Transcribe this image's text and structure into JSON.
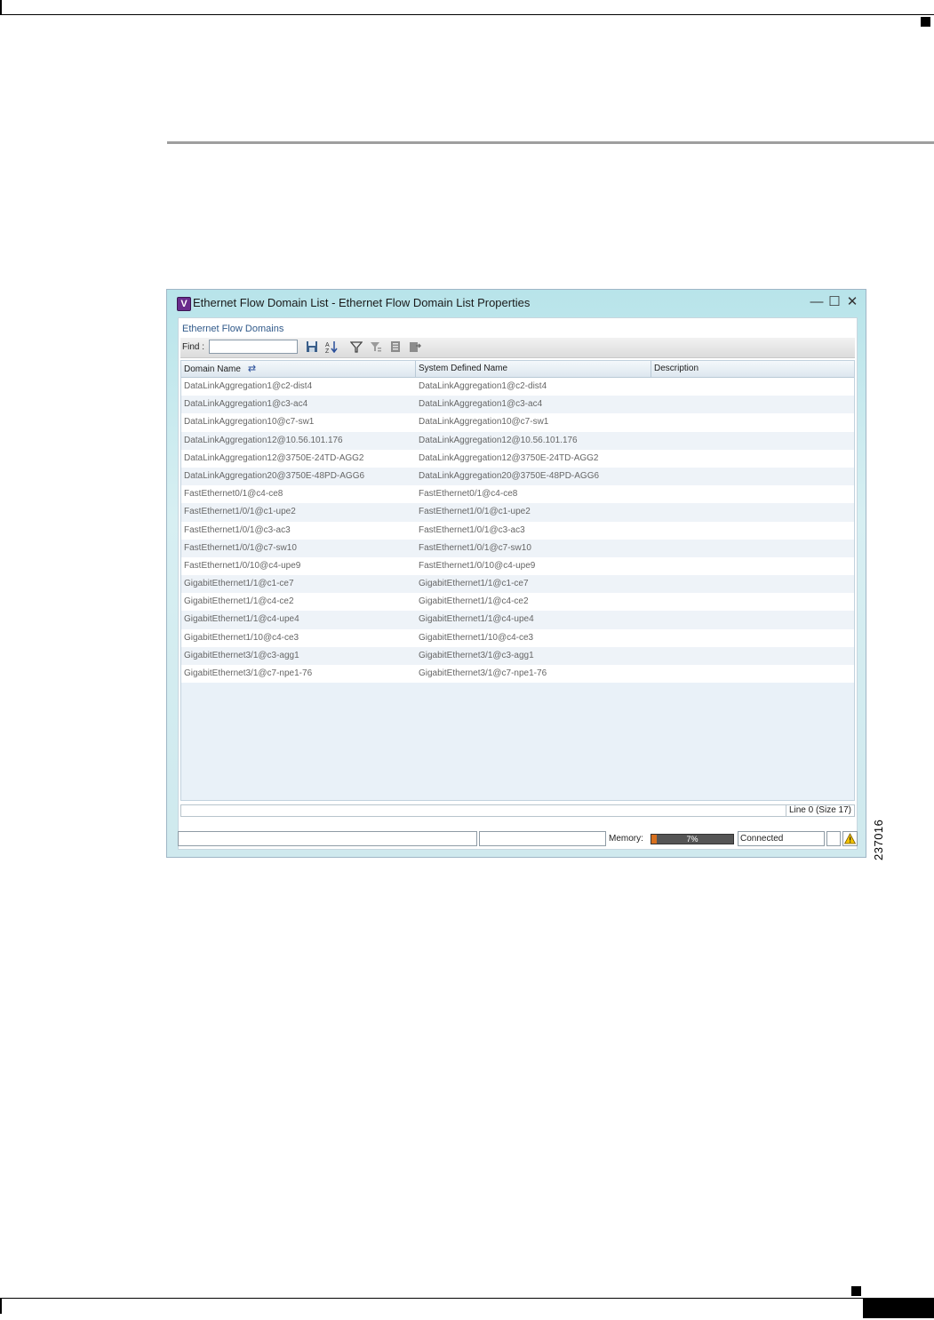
{
  "figure_id": "237016",
  "window": {
    "app_icon_letter": "V",
    "title": "Ethernet Flow Domain List - Ethernet Flow Domain List Properties",
    "minimize_glyph": "—",
    "maximize_glyph": "☐",
    "close_glyph": "✕"
  },
  "panel": {
    "title": "Ethernet Flow Domains",
    "find_label": "Find :",
    "find_value": ""
  },
  "toolbar": {
    "icons": [
      "save-icon",
      "sort-icon",
      "filter-icon",
      "advanced-filter-icon",
      "export-icon",
      "export-all-icon"
    ]
  },
  "table": {
    "columns": [
      "Domain Name",
      "System Defined Name",
      "Description"
    ],
    "rows": [
      [
        "DataLinkAggregation1@c2-dist4",
        "DataLinkAggregation1@c2-dist4",
        ""
      ],
      [
        "DataLinkAggregation1@c3-ac4",
        "DataLinkAggregation1@c3-ac4",
        ""
      ],
      [
        "DataLinkAggregation10@c7-sw1",
        "DataLinkAggregation10@c7-sw1",
        ""
      ],
      [
        "DataLinkAggregation12@10.56.101.176",
        "DataLinkAggregation12@10.56.101.176",
        ""
      ],
      [
        "DataLinkAggregation12@3750E-24TD-AGG2",
        "DataLinkAggregation12@3750E-24TD-AGG2",
        ""
      ],
      [
        "DataLinkAggregation20@3750E-48PD-AGG6",
        "DataLinkAggregation20@3750E-48PD-AGG6",
        ""
      ],
      [
        "FastEthernet0/1@c4-ce8",
        "FastEthernet0/1@c4-ce8",
        ""
      ],
      [
        "FastEthernet1/0/1@c1-upe2",
        "FastEthernet1/0/1@c1-upe2",
        ""
      ],
      [
        "FastEthernet1/0/1@c3-ac3",
        "FastEthernet1/0/1@c3-ac3",
        ""
      ],
      [
        "FastEthernet1/0/1@c7-sw10",
        "FastEthernet1/0/1@c7-sw10",
        ""
      ],
      [
        "FastEthernet1/0/10@c4-upe9",
        "FastEthernet1/0/10@c4-upe9",
        ""
      ],
      [
        "GigabitEthernet1/1@c1-ce7",
        "GigabitEthernet1/1@c1-ce7",
        ""
      ],
      [
        "GigabitEthernet1/1@c4-ce2",
        "GigabitEthernet1/1@c4-ce2",
        ""
      ],
      [
        "GigabitEthernet1/1@c4-upe4",
        "GigabitEthernet1/1@c4-upe4",
        ""
      ],
      [
        "GigabitEthernet1/10@c4-ce3",
        "GigabitEthernet1/10@c4-ce3",
        ""
      ],
      [
        "GigabitEthernet3/1@c3-agg1",
        "GigabitEthernet3/1@c3-agg1",
        ""
      ],
      [
        "GigabitEthernet3/1@c7-npe1-76",
        "GigabitEthernet3/1@c7-npe1-76",
        ""
      ]
    ]
  },
  "footer": {
    "line_info": "Line 0 (Size 17)"
  },
  "status": {
    "memory_label": "Memory:",
    "memory_text": "7%",
    "memory_fraction": 0.07,
    "connection": "Connected"
  },
  "colors": {
    "memory_fill": "#d8701e",
    "warning": "#f2c200"
  }
}
